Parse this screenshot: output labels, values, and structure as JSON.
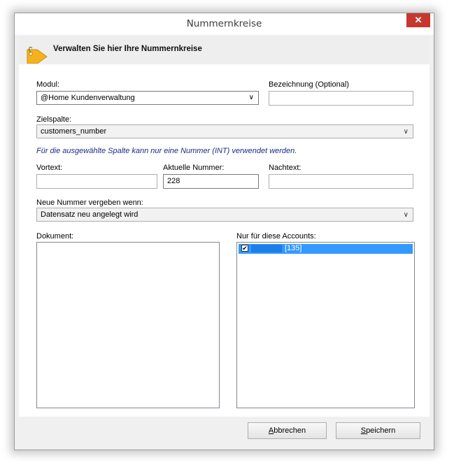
{
  "window": {
    "title": "Nummernkreise",
    "close_glyph": "✕"
  },
  "header": {
    "title": "Verwalten Sie hier Ihre Nummernkreise",
    "icon": "tag-icon"
  },
  "form": {
    "modul_label": "Modul:",
    "modul_value": "@Home Kundenverwaltung",
    "bezeichnung_label": "Bezeichnung (Optional)",
    "bezeichnung_value": "",
    "zielspalte_label": "Zielspalte:",
    "zielspalte_value": "customers_number",
    "info_text": "Für die ausgewählte Spalte kann nur eine Nummer (INT) verwendet werden.",
    "vortext_label": "Vortext:",
    "vortext_value": "",
    "aktuelle_label": "Aktuelle Nummer:",
    "aktuelle_value": "228",
    "nachtext_label": "Nachtext:",
    "nachtext_value": "",
    "neue_label": "Neue Nummer vergeben wenn:",
    "neue_value": "Datensatz neu angelegt wird",
    "dokument_label": "Dokument:",
    "accounts_label": "Nur für diese Accounts:",
    "accounts": [
      {
        "id_text": "[135]",
        "checked": true
      }
    ]
  },
  "footer": {
    "cancel_mnemonic": "A",
    "cancel_rest": "bbrechen",
    "save_mnemonic": "S",
    "save_rest": "peichern"
  },
  "colors": {
    "selection": "#3399ff",
    "close": "#c7372f",
    "info": "#1b2a8a"
  }
}
